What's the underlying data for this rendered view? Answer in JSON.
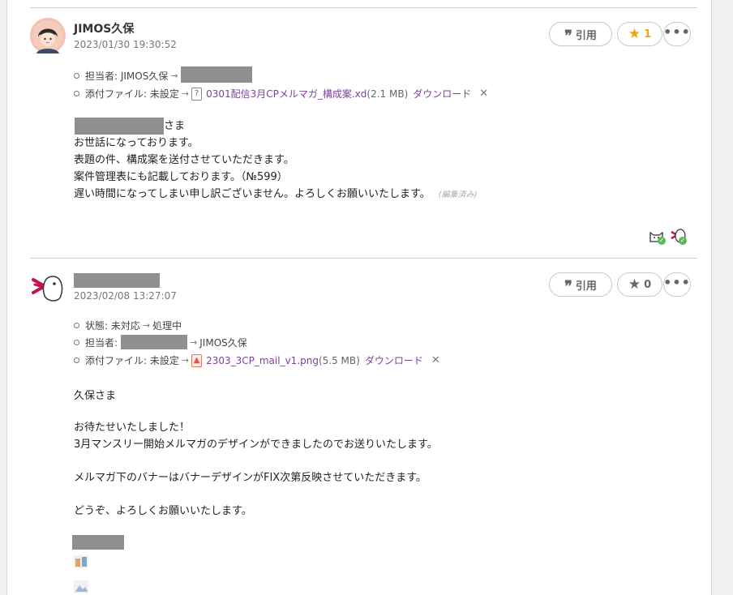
{
  "comments": [
    {
      "author": "JIMOS久保",
      "time": "2023/01/30 19:30:52",
      "quote_label": "引用",
      "star_count": "1",
      "more": "•••",
      "meta": {
        "assignee_label": "担当者: JIMOS久保",
        "attach_label": "添付ファイル: 未設定",
        "file_name": "0301配信3月CPメルマガ_構成案.xd",
        "file_size": "(2.1 MB)",
        "download": "ダウンロード",
        "file_icon": "?"
      },
      "body": [
        "さま",
        "お世話になっております。",
        "表題の件、構成案を送付させていただきます。",
        "案件管理表にも記載しております。（№599）",
        "遅い時間になってしまい申し訳ございません。よろしくお願いいたします。"
      ],
      "edited": "(編集済み)"
    },
    {
      "time": "2023/02/08 13:27:07",
      "quote_label": "引用",
      "star_count": "0",
      "more": "•••",
      "meta": {
        "status_label": "状態: 未対応",
        "status_new": "処理中",
        "assignee_label": "担当者:",
        "assignee_new": "JIMOS久保",
        "attach_label": "添付ファイル: 未設定",
        "file_name": "2303_3CP_mail_v1.png",
        "file_size": "(5.5 MB)",
        "download": "ダウンロード"
      },
      "body": [
        "久保さま",
        "お待たせいたしました！",
        "3月マンスリー開始メルマガのデザインができましたのでお送りいたします。",
        "メルマガ下のバナーはバナーデザインがFIX次第反映させていただきます。",
        "どうぞ、よろしくお願いいたします。"
      ]
    }
  ],
  "symbols": {
    "arrow": "→",
    "close": "✕",
    "quote": "❞",
    "star": "★"
  },
  "colors": {
    "link": "#7b3f9e",
    "star_active": "#f0a30a",
    "star_inactive": "#666666",
    "check": "#5cb85c"
  }
}
